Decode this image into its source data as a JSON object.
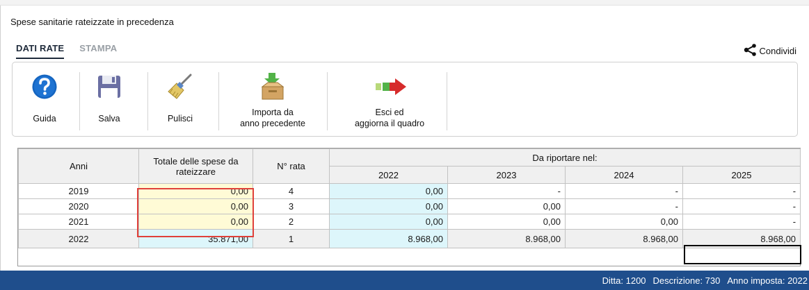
{
  "window": {
    "title": "Spese sanitarie rateizzate in precedenza"
  },
  "tabs": [
    {
      "label": "DATI RATE",
      "active": true
    },
    {
      "label": "STAMPA",
      "active": false
    }
  ],
  "share": {
    "label": "Condividi",
    "icon": "share-icon"
  },
  "toolbar": {
    "guida": {
      "label": "Guida",
      "icon": "help-icon"
    },
    "salva": {
      "label": "Salva",
      "icon": "floppy-disk-icon"
    },
    "pulisci": {
      "label": "Pulisci",
      "icon": "broom-icon"
    },
    "importa": {
      "label": "Importa da\nanno precedente",
      "icon": "import-box-icon"
    },
    "esci": {
      "label": "Esci ed\naggiorna il quadro",
      "icon": "exit-arrow-icon"
    }
  },
  "grid": {
    "headers": {
      "anni": "Anni",
      "totale": "Totale delle spese da rateizzare",
      "rata": "N° rata",
      "riportare": "Da riportare nel:",
      "years": [
        "2022",
        "2023",
        "2024",
        "2025"
      ]
    },
    "rows": [
      {
        "anno": "2019",
        "totale": "0,00",
        "rata": "4",
        "y2022": "0,00",
        "y2023": "-",
        "y2024": "-",
        "y2025": "-"
      },
      {
        "anno": "2020",
        "totale": "0,00",
        "rata": "3",
        "y2022": "0,00",
        "y2023": "0,00",
        "y2024": "-",
        "y2025": "-"
      },
      {
        "anno": "2021",
        "totale": "0,00",
        "rata": "2",
        "y2022": "0,00",
        "y2023": "0,00",
        "y2024": "0,00",
        "y2025": "-"
      }
    ],
    "summary": {
      "anno": "2022",
      "totale": "35.871,00",
      "rata": "1",
      "y2022": "8.968,00",
      "y2023": "8.968,00",
      "y2024": "8.968,00",
      "y2025": "8.968,00"
    }
  },
  "status": {
    "ditta": "Ditta: 1200",
    "descrizione": "Descrizione: 730",
    "anno": "Anno imposta: 2022"
  },
  "colors": {
    "status_bar": "#1f4e8c",
    "input_yellow": "#fffbd6",
    "calc_cyan": "#ddf6fb",
    "highlight_red": "#e0413a"
  }
}
